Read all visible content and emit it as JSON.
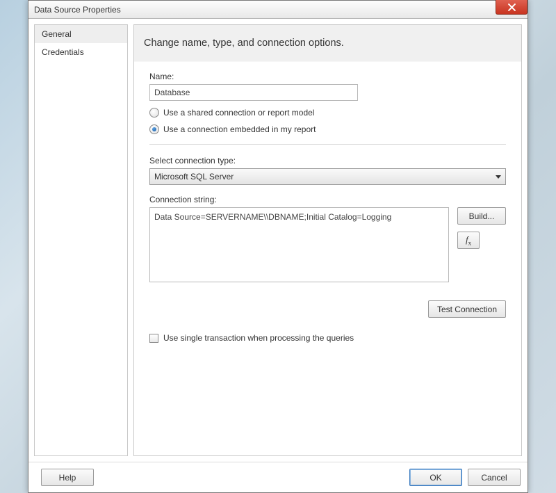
{
  "window": {
    "title": "Data Source Properties"
  },
  "sidebar": {
    "items": [
      {
        "label": "General",
        "selected": true
      },
      {
        "label": "Credentials",
        "selected": false
      }
    ]
  },
  "header": {
    "text": "Change name, type, and connection options."
  },
  "fields": {
    "name_label": "Name:",
    "name_value": "Database",
    "radio_shared_label": "Use a shared connection or report model",
    "radio_embedded_label": "Use a connection embedded in my report",
    "connection_type_label": "Select connection type:",
    "connection_type_value": "Microsoft SQL Server",
    "connection_string_label": "Connection string:",
    "connection_string_value": "Data Source=SERVERNAME\\\\DBNAME;Initial Catalog=Logging",
    "single_transaction_label": "Use single transaction when processing the queries"
  },
  "buttons": {
    "build": "Build...",
    "fx": "fx",
    "test_connection": "Test Connection",
    "help": "Help",
    "ok": "OK",
    "cancel": "Cancel"
  }
}
